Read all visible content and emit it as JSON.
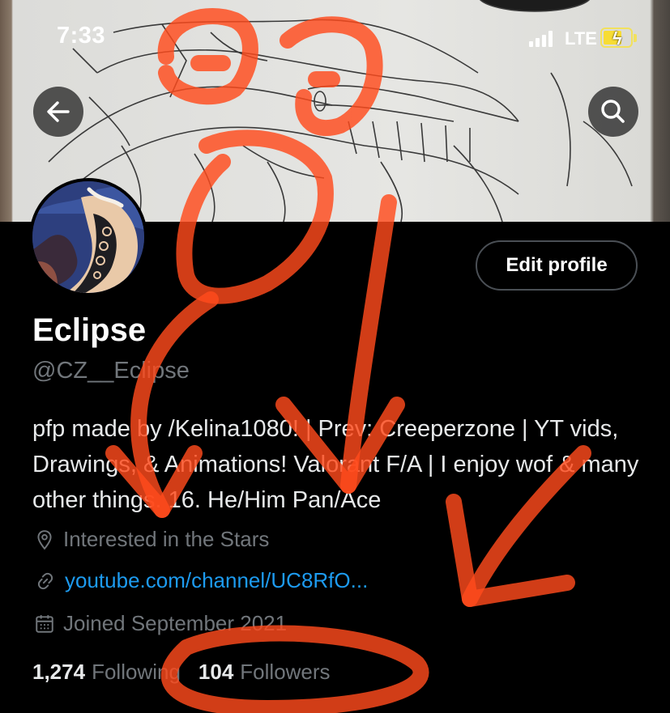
{
  "status_bar": {
    "time": "7:33",
    "network": "LTE",
    "battery_color": "#f7dc34"
  },
  "header": {
    "back_icon": "back-arrow-icon",
    "search_icon": "search-icon"
  },
  "profile": {
    "edit_button_label": "Edit profile",
    "display_name": "Eclipse",
    "handle": "@CZ__Eclipse",
    "bio": "pfp made by /Kelina1080! | Prev: Creeperzone | YT vids, Drawings, & Animations! Valorant F/A | I enjoy wof & many other things. 16. He/Him Pan/Ace",
    "location": "Interested in the Stars",
    "link": "youtube.com/channel/UC8RfO...",
    "joined": "Joined September 2021",
    "following_count": "1,274",
    "following_label": "Following",
    "followers_count": "104",
    "followers_label": "Followers"
  },
  "colors": {
    "background": "#000000",
    "link": "#1d9bf0",
    "muted_text": "#71767b",
    "annotation": "#ff4a1c"
  }
}
